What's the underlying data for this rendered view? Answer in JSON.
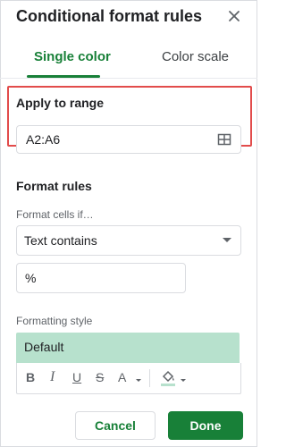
{
  "panel": {
    "title": "Conditional format rules",
    "close_icon": "close-icon"
  },
  "tabs": [
    {
      "label": "Single color",
      "active": true
    },
    {
      "label": "Color scale",
      "active": false
    }
  ],
  "apply_range": {
    "label": "Apply to range",
    "value": "A2:A6",
    "icon": "grid-icon"
  },
  "format_rules": {
    "label": "Format rules",
    "condition_label": "Format cells if…",
    "condition_value": "Text contains",
    "value": "%"
  },
  "formatting_style": {
    "label": "Formatting style",
    "preset": "Default",
    "preview_bg": "#b7e1cd",
    "toolbar": {
      "bold": "B",
      "italic": "I",
      "underline": "U",
      "strike": "S",
      "text_color": "A"
    }
  },
  "actions": {
    "cancel": "Cancel",
    "done": "Done"
  },
  "colors": {
    "accent": "#188038",
    "highlight_border": "#e24c4b"
  }
}
